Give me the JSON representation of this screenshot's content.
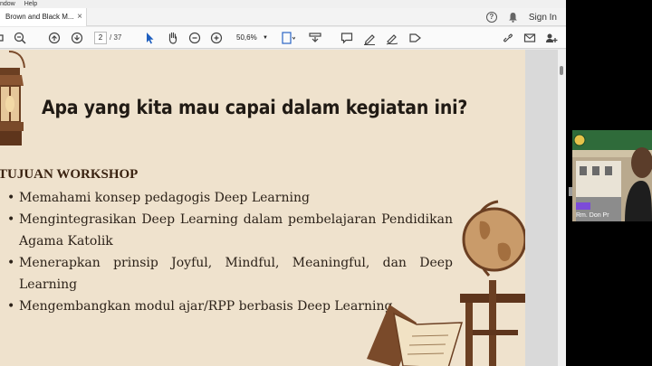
{
  "menubar": {
    "items": [
      "ndow",
      "Help"
    ]
  },
  "tab": {
    "title": "Brown and Black M...",
    "close": "×"
  },
  "header": {
    "sign_in": "Sign In"
  },
  "toolbar": {
    "page_current": "2",
    "page_total": "/ 37",
    "zoom": "50,6%"
  },
  "slide": {
    "title": "Apa yang kita mau capai dalam kegiatan ini?",
    "heading": "TUJUAN WORKSHOP",
    "bullets": [
      "Memahami konsep pedagogis Deep Learning",
      "Mengintegrasikan Deep Learning dalam pembelajaran Pendidikan Agama Katolik",
      "Menerapkan prinsip Joyful, Mindful, Meaningful, dan Deep Learning",
      "Mengembangkan modul ajar/RPP berbasis Deep Learning"
    ]
  },
  "video": {
    "participant_name": "Rm. Don Pr"
  },
  "colors": {
    "slide_bg": "#efe2cd",
    "title_text": "#201a14",
    "heading_text": "#3a2210"
  },
  "icons": [
    "print-icon",
    "zoom-out-icon",
    "prev-page-icon",
    "next-page-icon",
    "hand-icon",
    "cursor-icon",
    "minus-icon",
    "plus-icon",
    "fit-page-icon",
    "scroll-mode-icon",
    "comment-icon",
    "highlight-icon",
    "sign-icon",
    "fill-sign-icon",
    "share-link-icon",
    "mail-icon",
    "share-user-icon",
    "help-icon",
    "bell-icon"
  ]
}
